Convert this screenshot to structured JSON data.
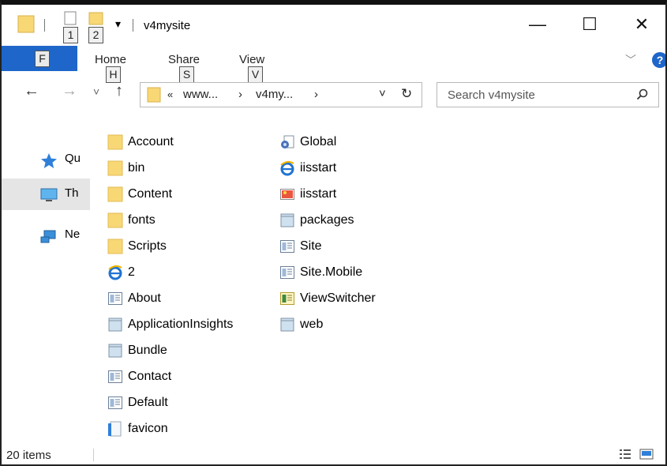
{
  "title": "v4mysite",
  "quick_access": {
    "keytip_1": "1",
    "keytip_2": "2",
    "dropdown_glyph": "▾"
  },
  "window_controls": {
    "minimize": "—",
    "maximize": "☐",
    "close": "✕"
  },
  "ribbon": {
    "file_keytip": "F",
    "tabs": [
      {
        "label": "Home",
        "keytip": "H"
      },
      {
        "label": "Share",
        "keytip": "S"
      },
      {
        "label": "View",
        "keytip": "V"
      }
    ],
    "help": "?"
  },
  "nav": {
    "back": "←",
    "forward": "→",
    "recent": "˅",
    "up": "↑"
  },
  "address": {
    "crumbs": [
      "«",
      "www...",
      "›",
      "v4my...",
      "›"
    ],
    "dropdown": "˅",
    "refresh": "↻"
  },
  "search": {
    "placeholder": "Search v4mysite"
  },
  "nav_pane": {
    "items": [
      {
        "label": "Qu",
        "icon": "star-icon"
      },
      {
        "label": "Th",
        "icon": "computer-icon"
      },
      {
        "label": "Ne",
        "icon": "network-icon"
      }
    ]
  },
  "files": {
    "column1": [
      {
        "name": "Account",
        "icon": "folder-icon"
      },
      {
        "name": "bin",
        "icon": "folder-icon"
      },
      {
        "name": "Content",
        "icon": "folder-icon"
      },
      {
        "name": "fonts",
        "icon": "folder-icon"
      },
      {
        "name": "Scripts",
        "icon": "folder-icon"
      },
      {
        "name": "2",
        "icon": "ie-html-icon"
      },
      {
        "name": "About",
        "icon": "aspx-icon"
      },
      {
        "name": "ApplicationInsights",
        "icon": "config-icon"
      },
      {
        "name": "Bundle",
        "icon": "config-icon"
      },
      {
        "name": "Contact",
        "icon": "aspx-icon"
      },
      {
        "name": "Default",
        "icon": "aspx-icon"
      },
      {
        "name": "favicon",
        "icon": "ico-icon"
      }
    ],
    "column2": [
      {
        "name": "Global",
        "icon": "asax-icon"
      },
      {
        "name": "iisstart",
        "icon": "ie-html-icon"
      },
      {
        "name": "iisstart",
        "icon": "image-icon"
      },
      {
        "name": "packages",
        "icon": "config-icon"
      },
      {
        "name": "Site",
        "icon": "aspx-icon"
      },
      {
        "name": "Site.Mobile",
        "icon": "aspx-icon"
      },
      {
        "name": "ViewSwitcher",
        "icon": "ascx-icon"
      },
      {
        "name": "web",
        "icon": "config-icon"
      }
    ]
  },
  "status": {
    "count": "20 items"
  }
}
